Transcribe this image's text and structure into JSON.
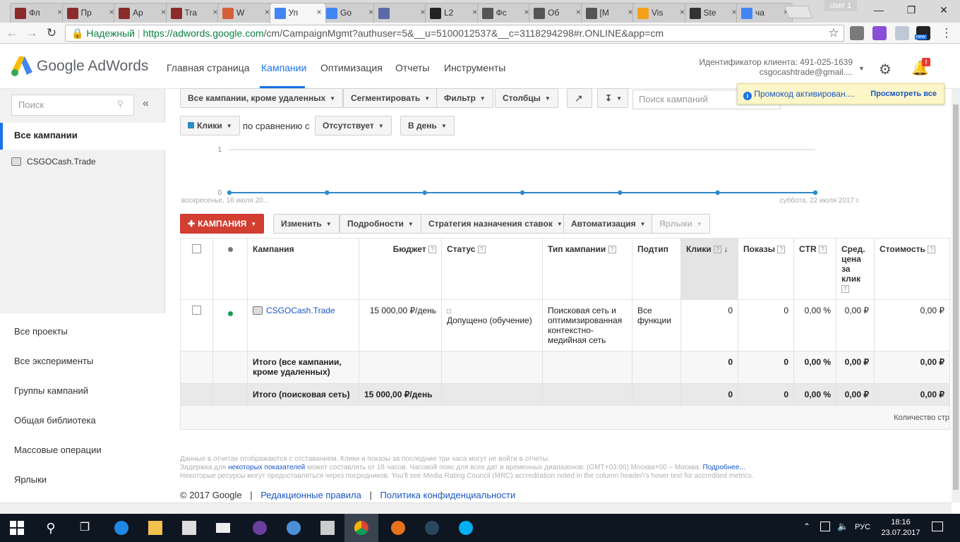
{
  "browser": {
    "tabs": [
      {
        "label": "Фл",
        "fav": "#8b2b2b"
      },
      {
        "label": "Пр",
        "fav": "#8b2b2b"
      },
      {
        "label": "Ар",
        "fav": "#8b2b2b"
      },
      {
        "label": "Tra",
        "fav": "#8b2b2b"
      },
      {
        "label": "W",
        "fav": "#d6603b"
      },
      {
        "label": "Уп",
        "fav": "#4285f4",
        "active": true
      },
      {
        "label": "Go",
        "fav": "#4285f4"
      },
      {
        "label": "",
        "fav": "#5b6aa6"
      },
      {
        "label": "L2",
        "fav": "#222222"
      },
      {
        "label": "Фс",
        "fav": "#555555"
      },
      {
        "label": "Об",
        "fav": "#555555"
      },
      {
        "label": "[М",
        "fav": "#555555"
      },
      {
        "label": "Vis",
        "fav": "#f3a01b"
      },
      {
        "label": "Ste",
        "fav": "#333333"
      },
      {
        "label": "ча",
        "fav": "#4285f4"
      }
    ],
    "user_badge": "user 1",
    "secure_label": "Надежный",
    "url_host": "https://adwords.google.com",
    "url_rest": "/cm/CampaignMgmt?authuser=5&__u=5100012537&__c=3118294298#r.ONLINE&app=cm",
    "ext_new_badge": "new"
  },
  "header": {
    "logo": "Google AdWords",
    "nav": [
      "Главная страница",
      "Кампании",
      "Оптимизация",
      "Отчеты",
      "Инструменты"
    ],
    "client_id": "Идентификатор клиента: 491-025-1639",
    "client_email": "csgocashtrade@gmail....",
    "notif_badge": "!"
  },
  "sidebar": {
    "search_placeholder": "Поиск",
    "collapse": "«",
    "all_campaigns": "Все кампании",
    "campaign": "CSGOCash.Trade",
    "links": [
      "Все проекты",
      "Все эксперименты",
      "Группы кампаний",
      "Общая библиотека",
      "Массовые операции",
      "Ярлыки"
    ]
  },
  "toolbar": {
    "filter_all": "Все кампании, кроме удаленных",
    "segment": "Сегментировать",
    "filter": "Фильтр",
    "columns": "Столбцы",
    "search_placeholder": "Поиск кампаний",
    "metric": "Клики",
    "compare_label": "по сравнению с",
    "compare_value": "Отсутствует",
    "period": "В день"
  },
  "promo": {
    "text": "Промокод активирован....",
    "link": "Просмотреть все"
  },
  "chart_data": {
    "type": "line",
    "x": [
      "2017-07-16",
      "2017-07-17",
      "2017-07-18",
      "2017-07-19",
      "2017-07-20",
      "2017-07-21",
      "2017-07-22"
    ],
    "values": [
      0,
      0,
      0,
      0,
      0,
      0,
      0
    ],
    "ylim": [
      0,
      1
    ],
    "ytick_labels": [
      "1",
      "0"
    ],
    "x_start_label": "воскресенье, 16 июля 20...",
    "x_end_label": "суббота, 22 июля 2017 г.",
    "color": "#2d8bc9"
  },
  "actions": {
    "new_campaign": "КАМПАНИЯ",
    "edit": "Изменить",
    "details": "Подробности",
    "bid_strategy": "Стратегия назначения ставок",
    "automation": "Автоматизация",
    "labels": "Ярлыки"
  },
  "table": {
    "headers": {
      "campaign": "Кампания",
      "budget": "Бюджет",
      "status": "Статус",
      "type": "Тип кампании",
      "subtype": "Подтип",
      "clicks": "Клики",
      "impressions": "Показы",
      "ctr": "CTR",
      "avg_cpc": "Сред. цена за клик",
      "cost": "Стоимость"
    },
    "row": {
      "campaign": "CSGOCash.Trade",
      "budget": "15 000,00 ₽/день",
      "status": "Допущено (обучение)",
      "type": "Поисковая сеть и оптимизированная контекстно-медийная сеть",
      "subtype": "Все функции",
      "clicks": "0",
      "impressions": "0",
      "ctr": "0,00 %",
      "avg_cpc": "0,00 ₽",
      "cost": "0,00 ₽",
      "status_color": "#0f9d58"
    },
    "total_all": {
      "label": "Итого (все кампании, кроме удаленных)",
      "clicks": "0",
      "impressions": "0",
      "ctr": "0,00 %",
      "avg_cpc": "0,00 ₽",
      "cost": "0,00 ₽"
    },
    "total_search": {
      "label": "Итого (поисковая сеть)",
      "budget": "15 000,00 ₽/день",
      "clicks": "0",
      "impressions": "0",
      "ctr": "0,00 %",
      "avg_cpc": "0,00 ₽",
      "cost": "0,00 ₽"
    },
    "pager_label": "Количество стр"
  },
  "footnotes": {
    "line1": "Данные в отчетах отображаются с отставанием. Клики и показы за последние три часа могут не войти в отчеты.",
    "line2_pre": "Задержка для",
    "line2_link": "некоторых показателей",
    "line2_post": "может составлять от 18 часов. Часовой пояс для всех дат и временных диапазонов: (GMT+03:00) Москва+00 – Москва.",
    "line2_more": "Подробнее...",
    "line3": "Некоторые ресурсы могут предоставляться через посредников. You'll see Media Rating Council (MRC) accreditation noted in the column header\\'s hover text for accredited metrics."
  },
  "footer": {
    "copyright": "© 2017 Google",
    "sep": "|",
    "policies": "Редакционные правила",
    "privacy": "Политика конфиденциальности"
  },
  "taskbar": {
    "lang": "РУС",
    "time": "18:16",
    "date": "23.07.2017"
  }
}
